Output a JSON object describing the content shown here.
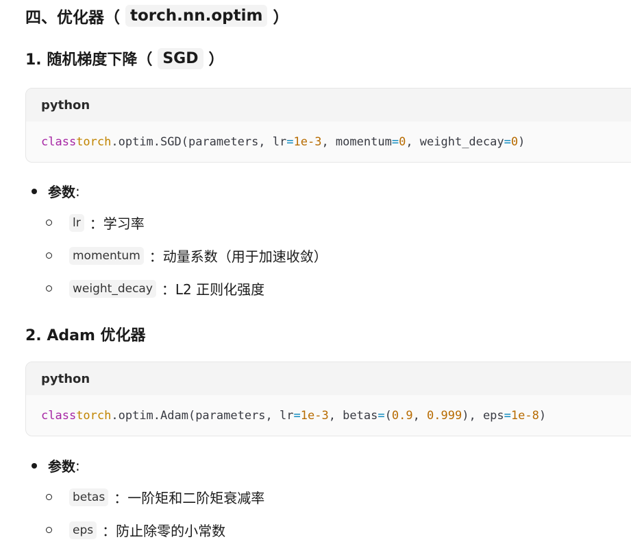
{
  "section4": {
    "prefix": "四、优化器（",
    "code": "torch.nn.optim",
    "suffix": "）"
  },
  "sgd": {
    "heading_prefix": "1. 随机梯度下降（",
    "heading_code": "SGD",
    "heading_suffix": "）",
    "lang": "python",
    "code": {
      "kw": "class",
      "mod": "torch",
      "t1": ".optim.SGD(parameters, lr",
      "eq1": "=",
      "n1": "1e-3",
      "t2": ", momentum",
      "eq2": "=",
      "n2": "0",
      "t3": ", weight_decay",
      "eq3": "=",
      "n3": "0",
      "t4": ")"
    },
    "params_label": "参数",
    "params_colon": ":",
    "params": [
      {
        "code": "lr",
        "desc": "：学习率"
      },
      {
        "code": "momentum",
        "desc": "：动量系数（用于加速收敛）"
      },
      {
        "code": "weight_decay",
        "desc": "：L2 正则化强度"
      }
    ]
  },
  "adam": {
    "heading": "2. Adam 优化器",
    "lang": "python",
    "code": {
      "kw": "class",
      "mod": "torch",
      "t1": ".optim.Adam(parameters, lr",
      "eq1": "=",
      "n1": "1e-3",
      "t2": ", betas",
      "eq2": "=",
      "p1": "(",
      "n2": "0.9",
      "t3": ", ",
      "n3": "0.999",
      "t4": "), eps",
      "eq3": "=",
      "n4": "1e-8",
      "t5": ")"
    },
    "params_label": "参数",
    "params_colon": ":",
    "params": [
      {
        "code": "betas",
        "desc": "：一阶矩和二阶矩衰减率"
      },
      {
        "code": "eps",
        "desc": "：防止除零的小常数"
      }
    ]
  }
}
